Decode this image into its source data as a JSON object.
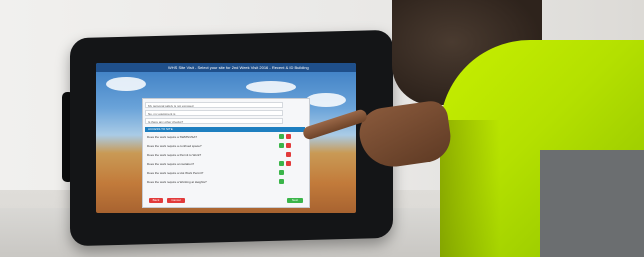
{
  "screen": {
    "app_bar_text": "WHS Site Visit - Select your site for 2nd Week Visit 2016 - Recent & ID Building",
    "field_1": "My personal safety is not exposed",
    "field_2": "No, my equipment is",
    "field_3": "Is there any other checks?",
    "section_title": "ACCESS TO SITE",
    "questions": [
      "Does the work require a SWMS/JSA?",
      "Does the work require a confined space?",
      "Does the work require a Permit to Work?",
      "Does the work require an isolation?",
      "Does the work require a Hot Work Permit?",
      "Does the work require a Working at Heights?"
    ],
    "btn_back": "Back",
    "btn_cancel": "Cancel",
    "btn_next": "Next"
  },
  "colors": {
    "check_yes": "#3bb54a",
    "check_no": "#e23b3b",
    "section_blue": "#1e7fc0"
  }
}
